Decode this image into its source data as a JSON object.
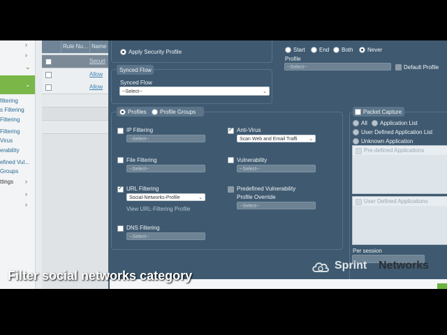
{
  "sidebar": {
    "items": [
      {
        "label": "",
        "chevron": "›"
      },
      {
        "label": "",
        "chevron": "⌄"
      },
      {
        "label": "",
        "chevron": "⌄"
      },
      {
        "label": "filtering"
      },
      {
        "label": "s Filtering"
      },
      {
        "label": "Filtering"
      },
      {
        "label": "Filtering"
      },
      {
        "label": "Virus"
      },
      {
        "label": "erability"
      },
      {
        "label": "efined Vul..."
      },
      {
        "label": "Groups"
      },
      {
        "label": "ttings",
        "chevron": "›"
      },
      {
        "label": "",
        "chevron": "›"
      },
      {
        "label": "",
        "chevron": "›"
      }
    ]
  },
  "table": {
    "headers": [
      "Rule Nu...",
      "Name"
    ],
    "rows": [
      {
        "link": "Securi"
      },
      {
        "link": "Allow"
      },
      {
        "link": "Allow"
      }
    ]
  },
  "dialog": {
    "apply_security_profile": "Apply Security Profile",
    "synced_flow_tab": "Synced Flow",
    "synced_flow_label": "Synced Flow",
    "synced_flow_value": "--Select--",
    "log": {
      "options": [
        "Start",
        "End",
        "Both",
        "Never"
      ],
      "profile_label": "Profile",
      "profile_placeholder": "--Select--",
      "default_profile_label": "Default Profile"
    },
    "profile_mode": {
      "profiles": "Profiles",
      "groups": "Profile Groups"
    },
    "ip_filtering": {
      "label": "IP Filtering",
      "value": "--Select--"
    },
    "file_filtering": {
      "label": "File Filtering",
      "value": "--Select--"
    },
    "url_filtering": {
      "label": "URL Filtering",
      "value": "Social-Networks-Profile",
      "link": "View URL-Filtering Profile"
    },
    "dns_filtering": {
      "label": "DNS Filtering",
      "value": "--Select--"
    },
    "anti_virus": {
      "label": "Anti-Virus",
      "value": "Scan Web and Email Traffi"
    },
    "vulnerability": {
      "label": "Vulnerability",
      "value": "--Select--"
    },
    "predef_vuln": {
      "label_line1": "Predefined Vulnerability",
      "label_line2": "Profile Override",
      "value": "--Select--"
    },
    "packet_capture": {
      "tab": "Packet Capture",
      "options": [
        "All",
        "Application List",
        "User Defined Application List",
        "Unknown Application"
      ],
      "predefined_list": "Pre-defined Applications",
      "user_defined_list": "User Defined Applications",
      "per_session": "Per session"
    }
  },
  "caption": "Filter social networks category",
  "logo": {
    "brand1": "Sprint",
    "brand2": "Networks"
  }
}
